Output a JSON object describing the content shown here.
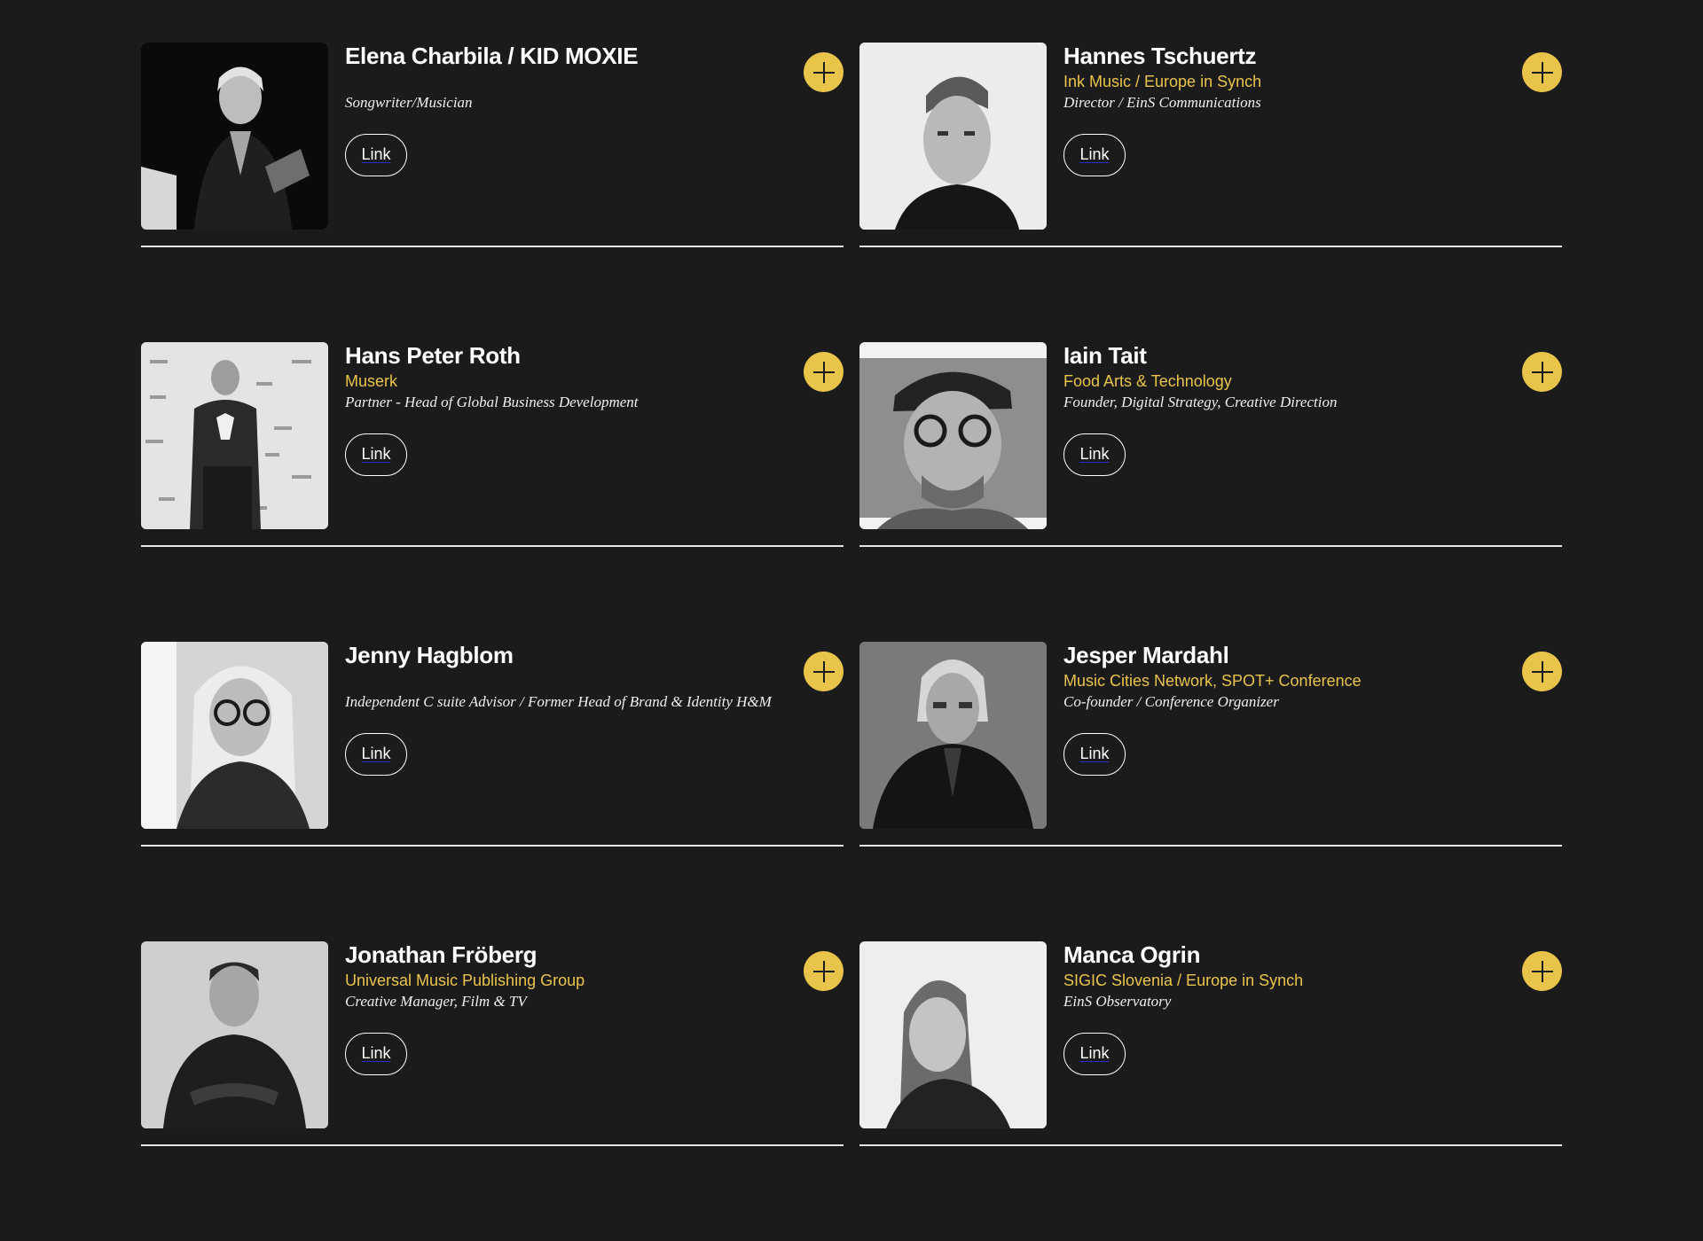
{
  "colors": {
    "background": "#1b1b1b",
    "accent": "#e9c44a",
    "text": "#ffffff"
  },
  "people": [
    {
      "name": "Elena Charbila / KID MOXIE",
      "org": "",
      "role": "Songwriter/Musician",
      "link_label": "Link",
      "expand_icon": "plus-icon"
    },
    {
      "name": "Hannes Tschuertz",
      "org": "Ink Music / Europe in Synch",
      "role": "Director / EinS Communications",
      "link_label": "Link",
      "expand_icon": "plus-icon"
    },
    {
      "name": "Hans Peter Roth",
      "org": "Muserk",
      "role": "Partner - Head of Global Business Development",
      "link_label": "Link",
      "expand_icon": "plus-icon"
    },
    {
      "name": "Iain Tait",
      "org": "Food Arts & Technology",
      "role": "Founder, Digital Strategy, Creative Direction",
      "link_label": "Link",
      "expand_icon": "plus-icon"
    },
    {
      "name": "Jenny Hagblom",
      "org": "",
      "role": "Independent C suite Advisor / Former Head of Brand & Identity H&M",
      "link_label": "Link",
      "expand_icon": "plus-icon"
    },
    {
      "name": "Jesper Mardahl",
      "org": "Music Cities Network, SPOT+ Conference",
      "role": "Co-founder / Conference Organizer",
      "link_label": "Link",
      "expand_icon": "plus-icon"
    },
    {
      "name": "Jonathan Fröberg",
      "org": "Universal Music Publishing Group",
      "role": "Creative Manager, Film & TV",
      "link_label": "Link",
      "expand_icon": "plus-icon"
    },
    {
      "name": "Manca Ogrin",
      "org": "SIGIC Slovenia / Europe in Synch",
      "role": "EinS Observatory",
      "link_label": "Link",
      "expand_icon": "plus-icon"
    }
  ]
}
